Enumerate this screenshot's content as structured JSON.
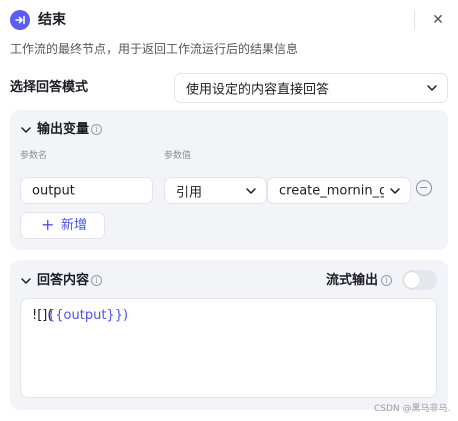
{
  "node": {
    "title": "结束",
    "description": "工作流的最终节点，用于返回工作流运行后的结果信息",
    "icon": "end-node-icon",
    "accent_color": "#5b5bf6"
  },
  "header": {
    "close_icon": "close-icon",
    "close_glyph": "✕"
  },
  "answer_mode": {
    "label": "选择回答模式",
    "selected": "使用设定的内容直接回答"
  },
  "output_vars": {
    "title": "输出变量",
    "info_glyph": "i",
    "col_param_name": "参数名",
    "col_param_value": "参数值",
    "rows": [
      {
        "name": "output",
        "source_type": "引用",
        "value": "create_mornin_g"
      }
    ],
    "add_label": "新增",
    "add_glyph": "+"
  },
  "answer_content": {
    "title": "回答内容",
    "stream_label": "流式输出",
    "stream_enabled": false,
    "content_prefix": "![](",
    "content_variable": "{{output}})"
  },
  "watermark": "CSDN @黑马非马.",
  "colors": {
    "link": "#4d53e8",
    "panel_bg": "#f3f4f7"
  }
}
